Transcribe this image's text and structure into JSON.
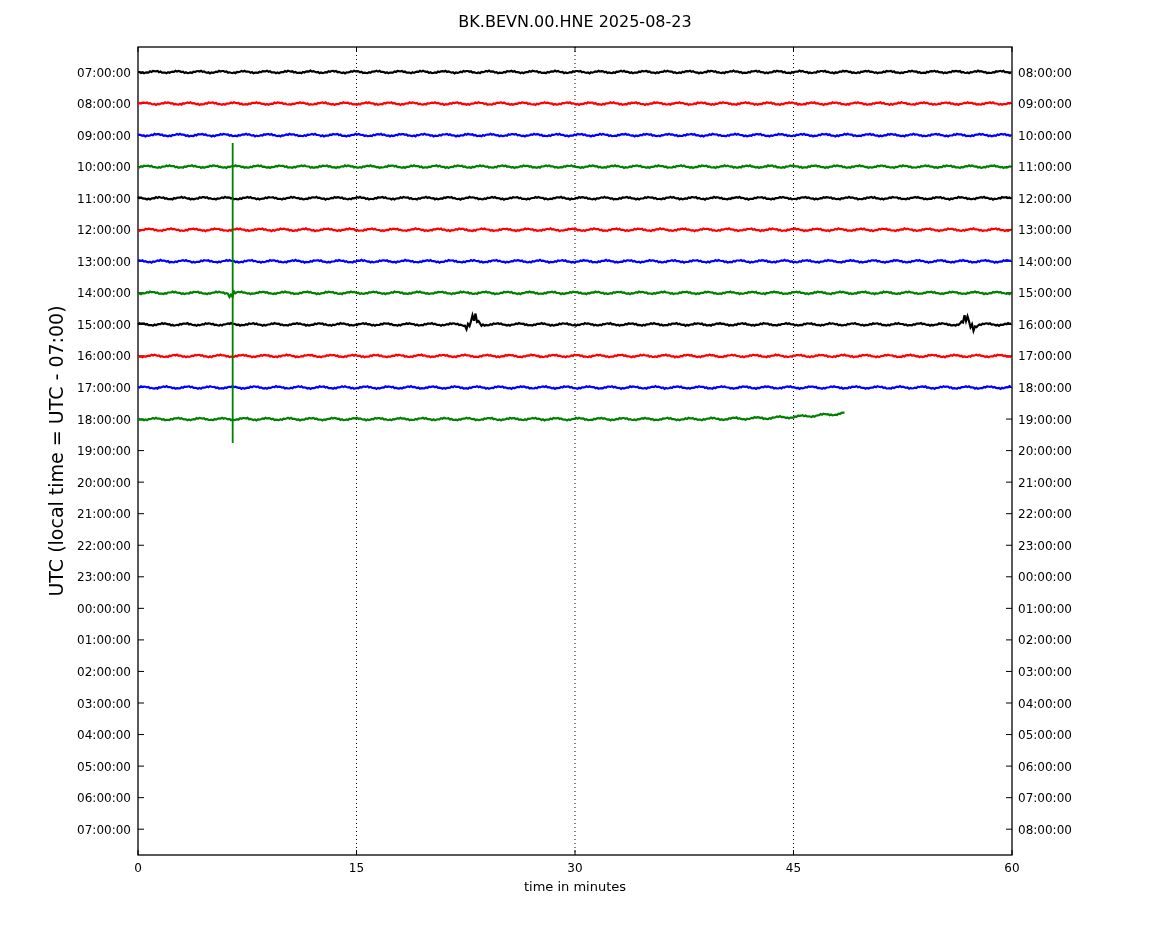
{
  "title": "BK.BEVN.00.HNE 2025-08-23",
  "chart": {
    "ylabel": "UTC (local time = UTC - 07:00)",
    "xlabel": "time in minutes",
    "xticks": [
      "0",
      "15",
      "30",
      "45",
      "60"
    ],
    "left_labels": [
      "07:00:00",
      "08:00:00",
      "09:00:00",
      "10:00:00",
      "11:00:00",
      "12:00:00",
      "13:00:00",
      "14:00:00",
      "15:00:00",
      "16:00:00",
      "17:00:00",
      "18:00:00",
      "19:00:00",
      "20:00:00",
      "21:00:00",
      "22:00:00",
      "23:00:00",
      "00:00:00",
      "01:00:00",
      "02:00:00",
      "03:00:00",
      "04:00:00",
      "05:00:00",
      "06:00:00",
      "07:00:00"
    ],
    "right_labels": [
      "08:00:00",
      "09:00:00",
      "10:00:00",
      "11:00:00",
      "12:00:00",
      "13:00:00",
      "14:00:00",
      "15:00:00",
      "16:00:00",
      "17:00:00",
      "18:00:00",
      "19:00:00",
      "20:00:00",
      "21:00:00",
      "22:00:00",
      "23:00:00",
      "00:00:00",
      "01:00:00",
      "02:00:00",
      "03:00:00",
      "04:00:00",
      "05:00:00",
      "06:00:00",
      "07:00:00",
      "08:00:00"
    ],
    "traces": [
      {
        "color": "#000000",
        "level": 1
      },
      {
        "color": "#ff0000",
        "level": 1
      },
      {
        "color": "#0000ff",
        "level": 1
      },
      {
        "color": "#008000",
        "level": 1
      },
      {
        "color": "#000000",
        "level": 1
      },
      {
        "color": "#ff0000",
        "level": 1
      },
      {
        "color": "#0000ff",
        "level": 1
      },
      {
        "color": "#008000",
        "level": 1
      },
      {
        "color": "#000000",
        "level": 1
      },
      {
        "color": "#ff0000",
        "level": 1
      },
      {
        "color": "#0000ff",
        "level": 1
      },
      {
        "color": "#008000",
        "level": 0.81
      }
    ]
  }
}
